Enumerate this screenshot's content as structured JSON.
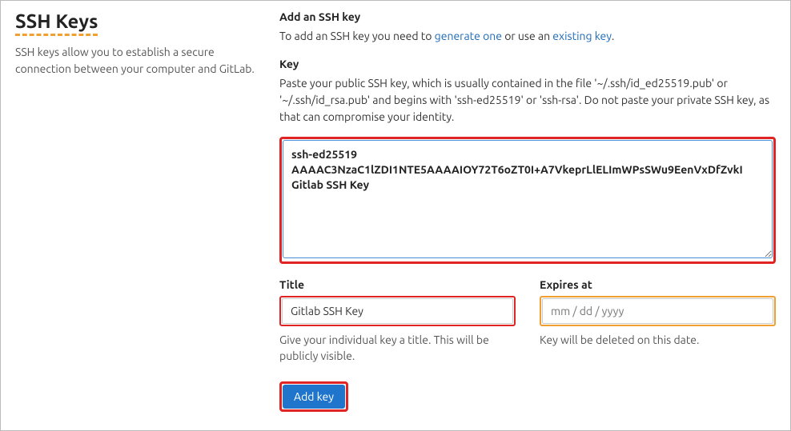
{
  "left": {
    "heading": "SSH Keys",
    "desc": "SSH keys allow you to establish a secure connection between your computer and GitLab."
  },
  "header": {
    "title": "Add an SSH key",
    "instruction_prefix": "To add an SSH key you need to ",
    "link_generate": "generate one",
    "instruction_mid": " or use an ",
    "link_existing": "existing key",
    "instruction_suffix": "."
  },
  "key": {
    "label": "Key",
    "help": "Paste your public SSH key, which is usually contained in the file '~/.ssh/id_ed25519.pub' or '~/.ssh/id_rsa.pub' and begins with 'ssh-ed25519' or 'ssh-rsa'. Do not paste your private SSH key, as that can compromise your identity.",
    "value": "ssh-ed25519 AAAAC3NzaC1lZDI1NTE5AAAAIOY72T6oZT0I+A7VkeprLlELImWPsSWu9EenVxDfZvkI Gitlab SSH Key"
  },
  "title_field": {
    "label": "Title",
    "value": "Gitlab SSH Key",
    "help": "Give your individual key a title. This will be publicly visible."
  },
  "expires_field": {
    "label": "Expires at",
    "placeholder": "mm / dd / yyyy",
    "help": "Key will be deleted on this date."
  },
  "submit": {
    "label": "Add key"
  }
}
